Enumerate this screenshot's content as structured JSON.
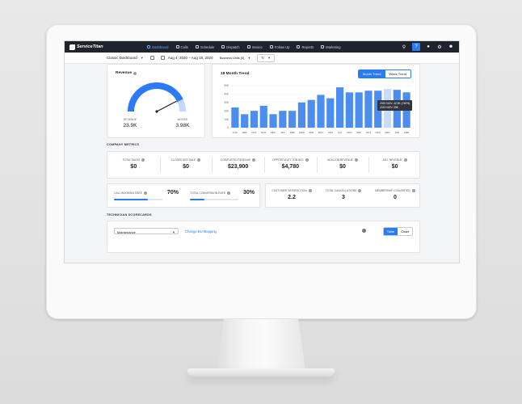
{
  "nav": {
    "brand": "ServiceTitan",
    "items": [
      {
        "label": "Dashboard",
        "active": true
      },
      {
        "label": "Calls",
        "active": false
      },
      {
        "label": "Schedule",
        "active": false
      },
      {
        "label": "Dispatch",
        "active": false
      },
      {
        "label": "Invoice",
        "active": false
      },
      {
        "label": "Follow Up",
        "active": false
      },
      {
        "label": "Reports",
        "active": false
      },
      {
        "label": "Marketing",
        "active": false
      }
    ]
  },
  "subbar": {
    "dashboard_select": "Classic Dashboard",
    "date_range": "Aug 4, 2020 – Aug 18, 2020",
    "business_units": "Business Units (5)"
  },
  "revenue": {
    "title": "Revenue",
    "gauge_fraction": 0.86,
    "revenue_label": "REVENUE",
    "revenue_value": "23.9K",
    "missed_label": "MISSED",
    "missed_value": "3.98K"
  },
  "trend": {
    "title": "18 Month Trend",
    "month_tab": "Month Trend",
    "week_tab": "Week Trend",
    "tooltip_line1": "2020 NOV: 42.9K (+50%)",
    "tooltip_line2": "2019 NOV: 25K",
    "colors": {
      "primary": "#4c8ef0",
      "highlight": "#c7dcfa"
    }
  },
  "chart_data": {
    "type": "bar",
    "categories": [
      "AUG",
      "SEP",
      "OCT",
      "NOV",
      "DEC",
      "JAN",
      "FEB",
      "MAR",
      "APR",
      "MAY",
      "JUN",
      "JUL",
      "AUG",
      "SEP",
      "OCT",
      "NOV",
      "DEC",
      "JAN",
      "FEB"
    ],
    "values": [
      24,
      16,
      20,
      26,
      16,
      20,
      20,
      30,
      33,
      39,
      35,
      48,
      42,
      42,
      44,
      44,
      46,
      45,
      42
    ],
    "highlight_index": 16,
    "ylim": [
      0,
      50
    ],
    "yticks": [
      "0",
      "10K",
      "20K",
      "30K",
      "40K",
      "50K"
    ]
  },
  "company_metrics": {
    "heading": "COMPANY METRICS",
    "items": [
      {
        "label": "TOTAL SALES",
        "value": "$0"
      },
      {
        "label": "CLOSED AVG SALE",
        "value": "$0"
      },
      {
        "label": "COMPLETED REVENUE",
        "value": "$23,900"
      },
      {
        "label": "OPPORTUNITY JOB AVG",
        "value": "$4,780"
      },
      {
        "label": "NON-JOB REVENUE",
        "value": "$0"
      },
      {
        "label": "ADJ. REVENUE",
        "value": "$0"
      }
    ]
  },
  "rates": [
    {
      "label": "CALL BOOKING RATE",
      "value": "70%",
      "fraction": 0.7
    },
    {
      "label": "TOTAL CONVERSION RATE",
      "value": "30%",
      "fraction": 0.3
    }
  ],
  "satisfaction": [
    {
      "label": "CUSTOMER SATISFACTION",
      "value": "2.2"
    },
    {
      "label": "TOTAL CANCELLATIONS",
      "value": "3"
    },
    {
      "label": "MEMBERSHIP CONVERTED",
      "value": "0"
    }
  ],
  "technician": {
    "heading": "TECHNICIAN SCORECARDS",
    "dropdown": "Maintenance",
    "link": "Change BU Mapping",
    "table_tab": "Table",
    "chart_tab": "Chart"
  }
}
